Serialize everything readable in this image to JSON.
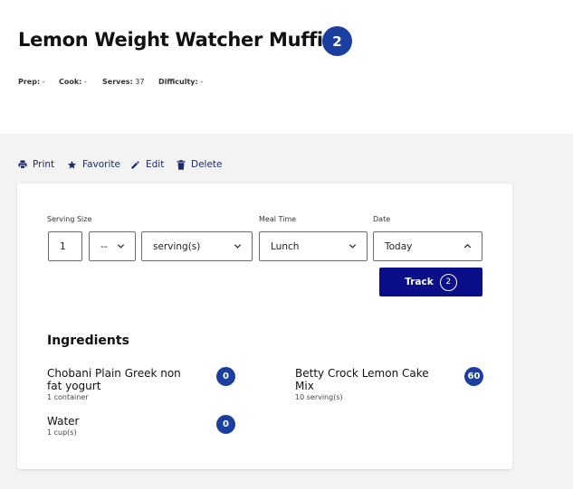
{
  "recipe": {
    "title": "Lemon Weight Watcher Muffins",
    "points": "2",
    "meta": {
      "prep_label": "Prep:",
      "prep_value": "-",
      "cook_label": "Cook:",
      "cook_value": "-",
      "serves_label": "Serves:",
      "serves_value": "37",
      "difficulty_label": "Difficulty:",
      "difficulty_value": "-"
    }
  },
  "actions": {
    "print": "Print",
    "favorite": "Favorite",
    "edit": "Edit",
    "delete": "Delete"
  },
  "tracker": {
    "serving_size_label": "Serving Size",
    "meal_time_label": "Meal Time",
    "date_label": "Date",
    "quantity_value": "1",
    "fraction_value": "--",
    "unit_value": "serving(s)",
    "meal_time_value": "Lunch",
    "date_value": "Today",
    "track_label": "Track",
    "track_points": "2"
  },
  "ingredients": {
    "heading": "Ingredients",
    "items": [
      {
        "name_line1": "Chobani Plain Greek non",
        "name_line2": "fat yogurt",
        "qty": "1 container",
        "points": "0"
      },
      {
        "name_line1": "Betty Crock Lemon Cake",
        "name_line2": "Mix",
        "qty": "10 serving(s)",
        "points": "60"
      },
      {
        "name_line1": "Water",
        "name_line2": "",
        "qty": "1 cup(s)",
        "points": "0"
      }
    ]
  },
  "colors": {
    "badge_blue": "#1a3fa0",
    "track_button": "#0a0f87",
    "action_text": "#1b2a6e",
    "page_bg": "#f3f3f3"
  },
  "icons": [
    "print-icon",
    "star-icon",
    "pencil-icon",
    "trash-icon",
    "chevron-down-icon",
    "chevron-up-icon"
  ]
}
